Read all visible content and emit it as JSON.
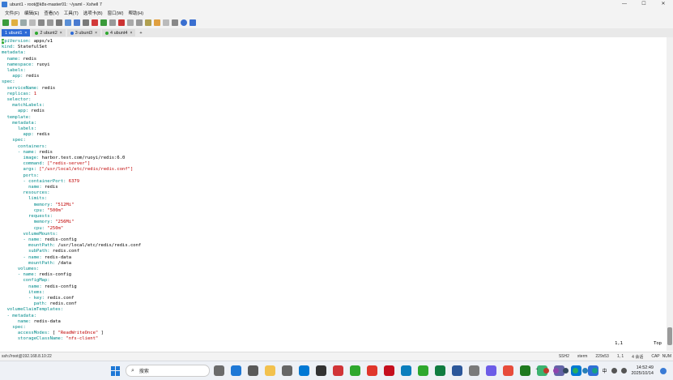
{
  "window": {
    "title": "ubunt1 - root@k8s-master01: ~/yaml - Xshell 7",
    "minimize": "—",
    "maximize": "☐",
    "close": "✕"
  },
  "menu": [
    "文件(F)",
    "编辑(E)",
    "查看(V)",
    "工具(T)",
    "选项卡(B)",
    "窗口(W)",
    "帮助(H)"
  ],
  "tabs": [
    {
      "label": "1 ubunt1",
      "active": true,
      "dot": "#2ea82e"
    },
    {
      "label": "2 ubunt2",
      "active": false,
      "dot": "#2ea82e"
    },
    {
      "label": "3 ubunt3",
      "active": false,
      "dot": "#2e6bd6"
    },
    {
      "label": "4 ubunt4",
      "active": false,
      "dot": "#2ea82e"
    }
  ],
  "tab_close": "×",
  "tab_add": "+",
  "editor": {
    "position": "1,1",
    "scroll": "Top",
    "lines": [
      [
        [
          "cursor",
          "a"
        ],
        [
          "k",
          "piVersion:"
        ],
        [
          "t",
          " apps/v1"
        ]
      ],
      [
        [
          "k",
          "kind:"
        ],
        [
          "t",
          " StatefulSet"
        ]
      ],
      [
        [
          "k",
          "metadata:"
        ]
      ],
      [
        [
          "t",
          "  "
        ],
        [
          "k",
          "name:"
        ],
        [
          "t",
          " redis"
        ]
      ],
      [
        [
          "t",
          "  "
        ],
        [
          "k",
          "namespace:"
        ],
        [
          "t",
          " ruoyi"
        ]
      ],
      [
        [
          "t",
          "  "
        ],
        [
          "k",
          "labels:"
        ]
      ],
      [
        [
          "t",
          "    "
        ],
        [
          "k",
          "app:"
        ],
        [
          "t",
          " redis"
        ]
      ],
      [
        [
          "k",
          "spec:"
        ]
      ],
      [
        [
          "t",
          "  "
        ],
        [
          "k",
          "serviceName:"
        ],
        [
          "t",
          " redis"
        ]
      ],
      [
        [
          "t",
          "  "
        ],
        [
          "k",
          "replicas:"
        ],
        [
          "t",
          " "
        ],
        [
          "n",
          "1"
        ]
      ],
      [
        [
          "t",
          "  "
        ],
        [
          "k",
          "selector:"
        ]
      ],
      [
        [
          "t",
          "    "
        ],
        [
          "k",
          "matchLabels:"
        ]
      ],
      [
        [
          "t",
          "      "
        ],
        [
          "k",
          "app:"
        ],
        [
          "t",
          " redis"
        ]
      ],
      [
        [
          "t",
          "  "
        ],
        [
          "k",
          "template:"
        ]
      ],
      [
        [
          "t",
          "    "
        ],
        [
          "k",
          "metadata:"
        ]
      ],
      [
        [
          "t",
          "      "
        ],
        [
          "k",
          "labels:"
        ]
      ],
      [
        [
          "t",
          "        "
        ],
        [
          "k",
          "app:"
        ],
        [
          "t",
          " redis"
        ]
      ],
      [
        [
          "t",
          "    "
        ],
        [
          "k",
          "spec:"
        ]
      ],
      [
        [
          "t",
          "      "
        ],
        [
          "k",
          "containers:"
        ]
      ],
      [
        [
          "t",
          "      "
        ],
        [
          "k",
          "- name:"
        ],
        [
          "t",
          " redis"
        ]
      ],
      [
        [
          "t",
          "        "
        ],
        [
          "k",
          "image:"
        ],
        [
          "t",
          " harbor.test.com/ruoyi/redis:6.0"
        ]
      ],
      [
        [
          "t",
          "        "
        ],
        [
          "k",
          "command:"
        ],
        [
          "t",
          " "
        ],
        [
          "s",
          "[\"redis-server\"]"
        ]
      ],
      [
        [
          "t",
          "        "
        ],
        [
          "k",
          "args:"
        ],
        [
          "t",
          " "
        ],
        [
          "s",
          "[\"/usr/local/etc/redis/redis.conf\"]"
        ]
      ],
      [
        [
          "t",
          "        "
        ],
        [
          "k",
          "ports:"
        ]
      ],
      [
        [
          "t",
          "        "
        ],
        [
          "k",
          "- containerPort:"
        ],
        [
          "t",
          " "
        ],
        [
          "n",
          "6379"
        ]
      ],
      [
        [
          "t",
          "          "
        ],
        [
          "k",
          "name:"
        ],
        [
          "t",
          " redis"
        ]
      ],
      [
        [
          "t",
          "        "
        ],
        [
          "k",
          "resources:"
        ]
      ],
      [
        [
          "t",
          "          "
        ],
        [
          "k",
          "limits:"
        ]
      ],
      [
        [
          "t",
          "            "
        ],
        [
          "k",
          "memory:"
        ],
        [
          "t",
          " "
        ],
        [
          "s",
          "\"512Mi\""
        ]
      ],
      [
        [
          "t",
          "            "
        ],
        [
          "k",
          "cpu:"
        ],
        [
          "t",
          " "
        ],
        [
          "s",
          "\"500m\""
        ]
      ],
      [
        [
          "t",
          "          "
        ],
        [
          "k",
          "requests:"
        ]
      ],
      [
        [
          "t",
          "            "
        ],
        [
          "k",
          "memory:"
        ],
        [
          "t",
          " "
        ],
        [
          "s",
          "\"256Mi\""
        ]
      ],
      [
        [
          "t",
          "            "
        ],
        [
          "k",
          "cpu:"
        ],
        [
          "t",
          " "
        ],
        [
          "s",
          "\"250m\""
        ]
      ],
      [
        [
          "t",
          "        "
        ],
        [
          "k",
          "volumeMounts:"
        ]
      ],
      [
        [
          "t",
          "        "
        ],
        [
          "k",
          "- name:"
        ],
        [
          "t",
          " redis-config"
        ]
      ],
      [
        [
          "t",
          "          "
        ],
        [
          "k",
          "mountPath:"
        ],
        [
          "t",
          " /usr/local/etc/redis/redis.conf"
        ]
      ],
      [
        [
          "t",
          "          "
        ],
        [
          "k",
          "subPath:"
        ],
        [
          "t",
          " redis.conf"
        ]
      ],
      [
        [
          "t",
          "        "
        ],
        [
          "k",
          "- name:"
        ],
        [
          "t",
          " redis-data"
        ]
      ],
      [
        [
          "t",
          "          "
        ],
        [
          "k",
          "mountPath:"
        ],
        [
          "t",
          " /data"
        ]
      ],
      [
        [
          "t",
          "      "
        ],
        [
          "k",
          "volumes:"
        ]
      ],
      [
        [
          "t",
          "      "
        ],
        [
          "k",
          "- name:"
        ],
        [
          "t",
          " redis-config"
        ]
      ],
      [
        [
          "t",
          "        "
        ],
        [
          "k",
          "configMap:"
        ]
      ],
      [
        [
          "t",
          "          "
        ],
        [
          "k",
          "name:"
        ],
        [
          "t",
          " redis-config"
        ]
      ],
      [
        [
          "t",
          "          "
        ],
        [
          "k",
          "items:"
        ]
      ],
      [
        [
          "t",
          "          "
        ],
        [
          "k",
          "- key:"
        ],
        [
          "t",
          " redis.conf"
        ]
      ],
      [
        [
          "t",
          "            "
        ],
        [
          "k",
          "path:"
        ],
        [
          "t",
          " redis.conf"
        ]
      ],
      [
        [
          "t",
          "  "
        ],
        [
          "k",
          "volumeClaimTemplates:"
        ]
      ],
      [
        [
          "t",
          "  "
        ],
        [
          "k",
          "- metadata:"
        ]
      ],
      [
        [
          "t",
          "      "
        ],
        [
          "k",
          "name:"
        ],
        [
          "t",
          " redis-data"
        ]
      ],
      [
        [
          "t",
          "    "
        ],
        [
          "k",
          "spec:"
        ]
      ],
      [
        [
          "t",
          "      "
        ],
        [
          "k",
          "accessModes:"
        ],
        [
          "t",
          " [ "
        ],
        [
          "s",
          "\"ReadWriteOnce\""
        ],
        [
          "t",
          " ]"
        ]
      ],
      [
        [
          "t",
          "      "
        ],
        [
          "k",
          "storageClassName:"
        ],
        [
          "t",
          " "
        ],
        [
          "s",
          "\"nfs-client\""
        ]
      ]
    ]
  },
  "status": {
    "connection": "ssh://root@192.168.8.10:22",
    "protocol": "SSH2",
    "term": "xterm",
    "size": "229x53",
    "cursor": "1, 1",
    "sessions": "4 会话",
    "caps": "CAP",
    "num": "NUM"
  },
  "taskbar": {
    "search_placeholder": "搜索",
    "apps": [
      "#6b6b6b",
      "#1e78d6",
      "#5a5a5a",
      "#f2c14e",
      "#666666",
      "#0078d4",
      "#333333",
      "#d13438",
      "#2ea82e",
      "#e0362c",
      "#c50f1f",
      "#0a7ebd",
      "#2ea82e",
      "#107c41",
      "#2b579a",
      "#7a7a7a",
      "#6c5ce7",
      "#e74c3c",
      "#1f7a1f",
      "#3cb371",
      "#6264a7",
      "#0078d4",
      "#2f6fd6"
    ],
    "time": "14:52:49",
    "date": "2025/10/14",
    "ime": "中"
  }
}
